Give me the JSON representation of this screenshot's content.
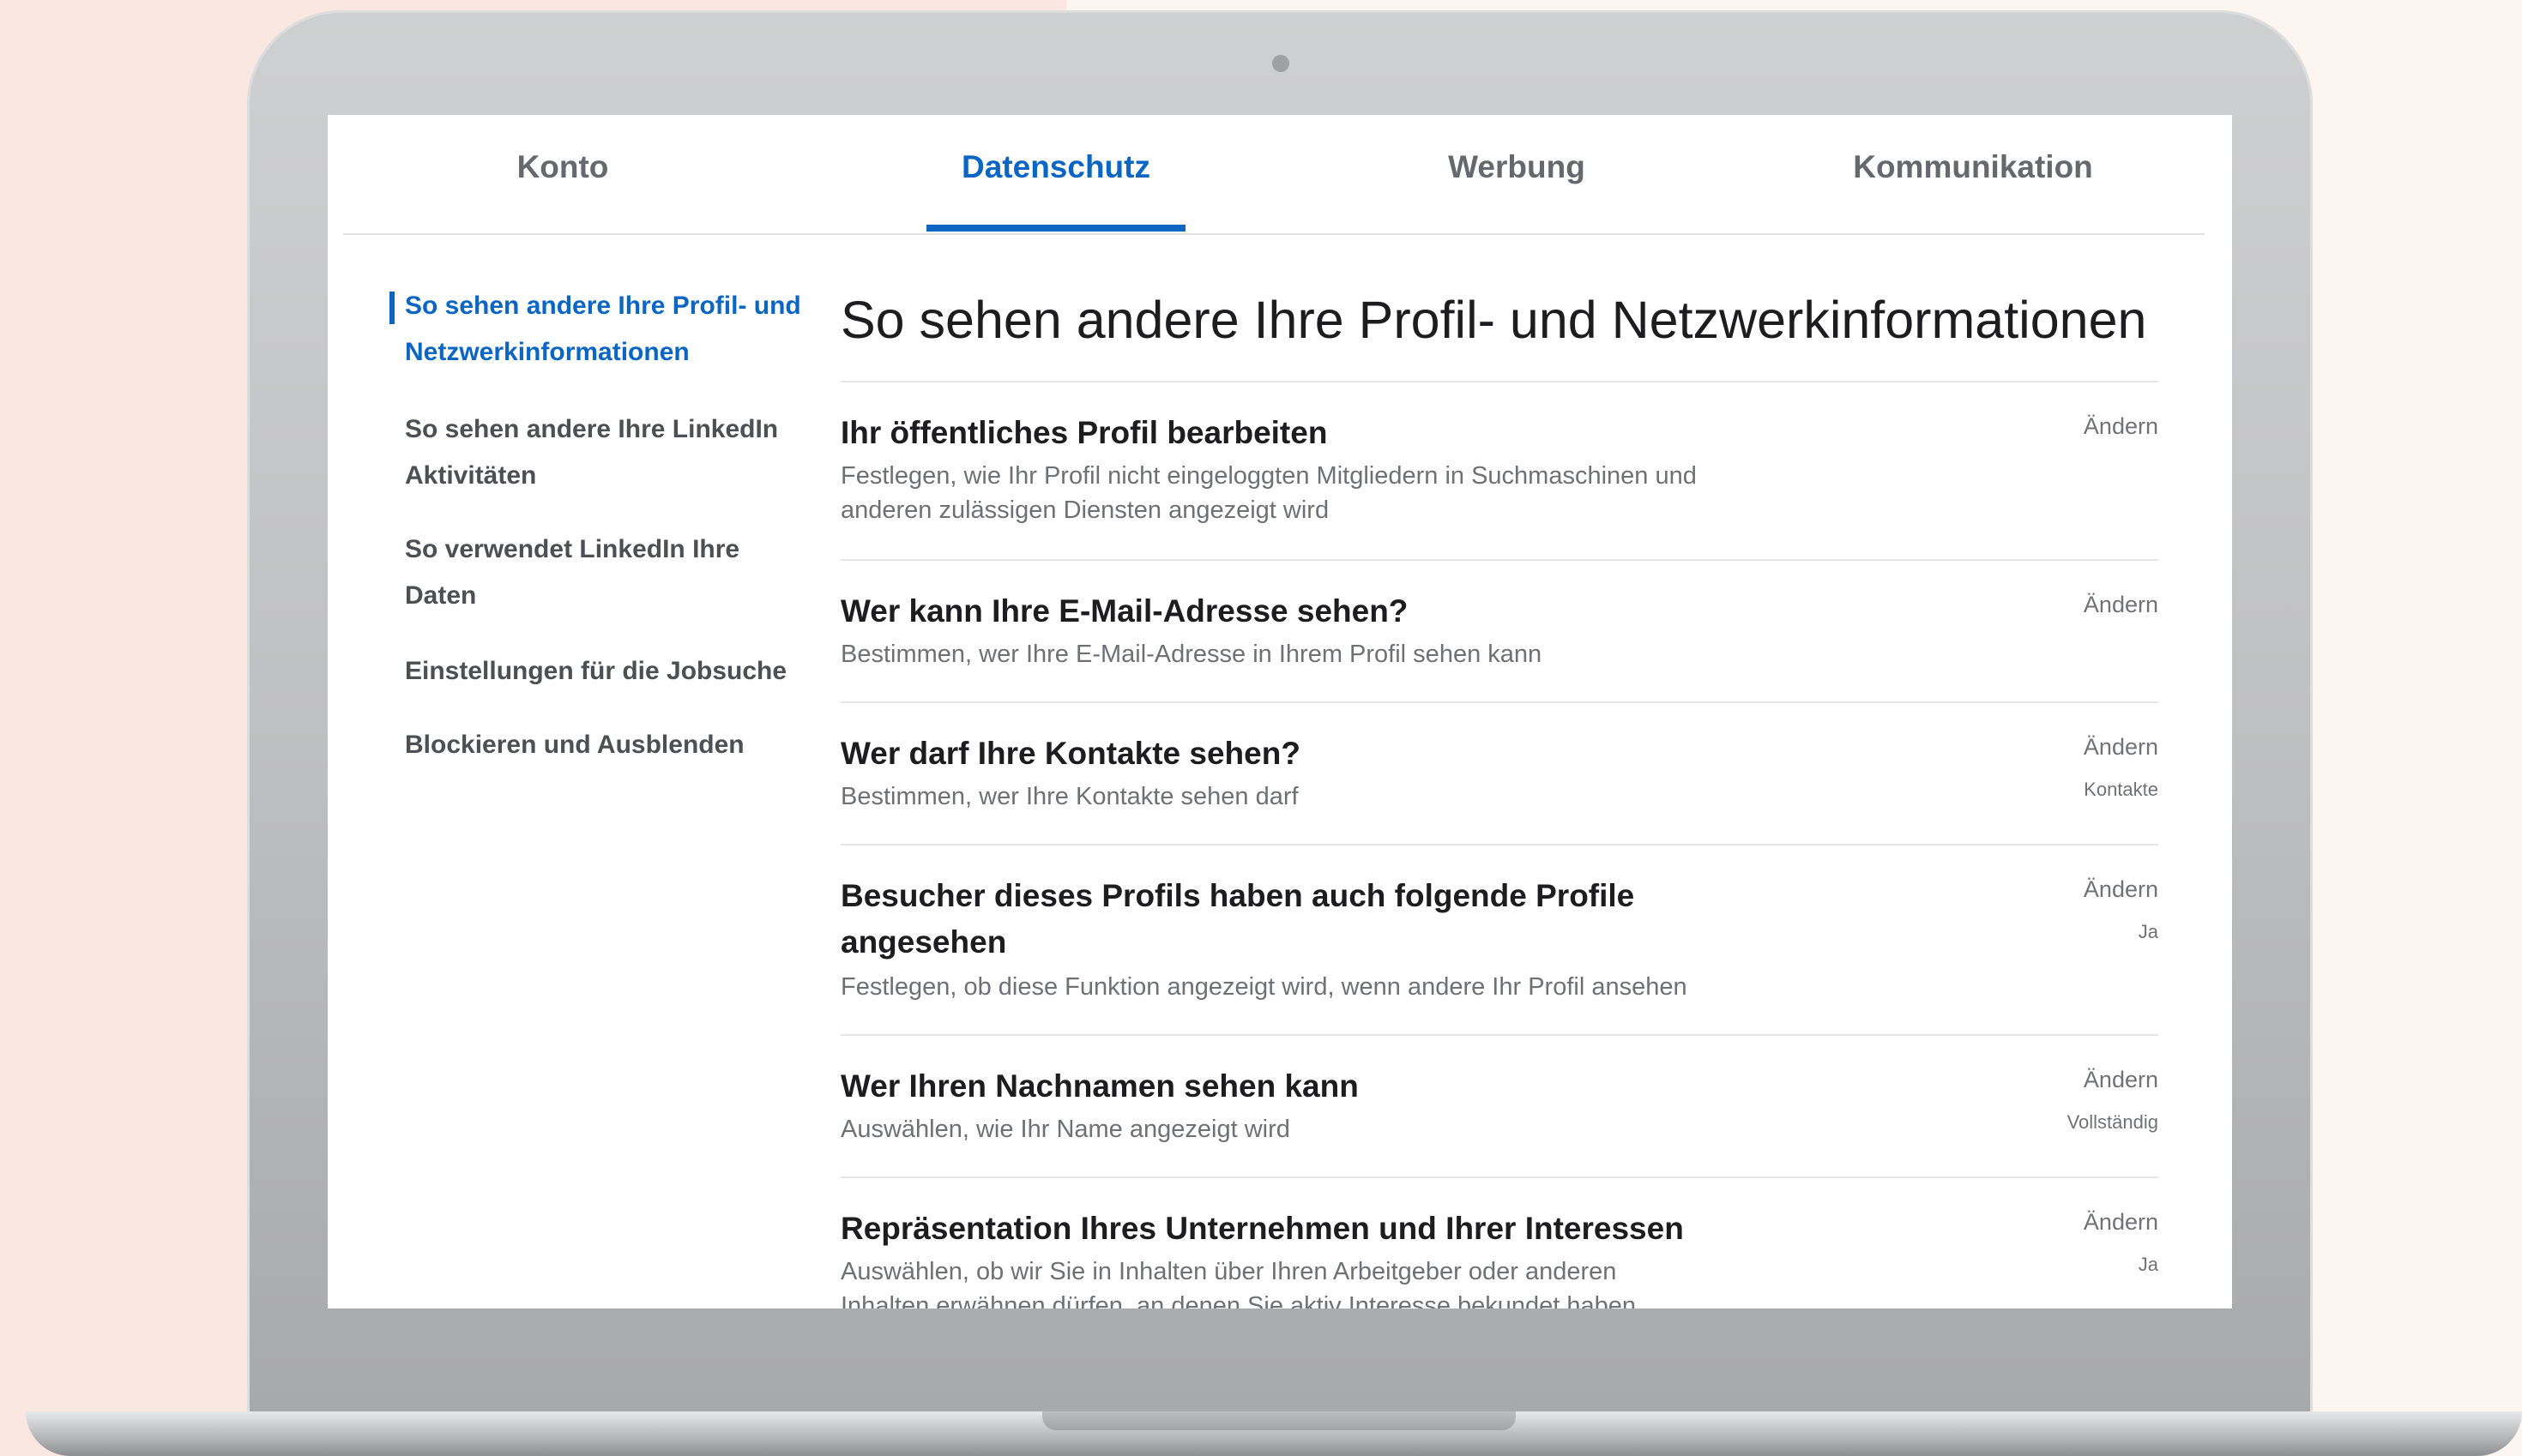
{
  "tabs": [
    {
      "label": "Konto"
    },
    {
      "label": "Datenschutz"
    },
    {
      "label": "Werbung"
    },
    {
      "label": "Kommunikation"
    }
  ],
  "active_tab": "Datenschutz",
  "sidebar": {
    "items": [
      {
        "line1": "So sehen andere Ihre Profil- und",
        "line2": "Netzwerkinformationen",
        "active": true
      },
      {
        "line1": "So sehen andere Ihre LinkedIn",
        "line2": "Aktivitäten"
      },
      {
        "line1": "So verwendet LinkedIn Ihre",
        "line2": "Daten"
      },
      {
        "line1": "Einstellungen für die Jobsuche"
      },
      {
        "line1": "Blockieren und Ausblenden"
      }
    ]
  },
  "main": {
    "title": "So sehen andere Ihre Profil- und Netzwerkinformationen",
    "rows": [
      {
        "title": "Ihr öffentliches Profil bearbeiten",
        "desc1": "Festlegen, wie Ihr Profil nicht eingeloggten Mitgliedern in Suchmaschinen und",
        "desc2": "anderen zulässigen Diensten angezeigt wird",
        "action": "Ändern"
      },
      {
        "title": "Wer kann Ihre E-Mail-Adresse sehen?",
        "desc1": "Bestimmen, wer Ihre E-Mail-Adresse in Ihrem Profil sehen kann",
        "action": "Ändern"
      },
      {
        "title": "Wer darf Ihre Kontakte sehen?",
        "desc1": "Bestimmen, wer Ihre Kontakte sehen darf",
        "action": "Ändern",
        "value": "Kontakte"
      },
      {
        "title1": "Besucher dieses Profils haben auch folgende Profile",
        "title2": "angesehen",
        "desc1": "Festlegen, ob diese Funktion angezeigt wird, wenn andere Ihr Profil ansehen",
        "action": "Ändern",
        "value": "Ja"
      },
      {
        "title": "Wer Ihren Nachnamen sehen kann",
        "desc1": "Auswählen, wie Ihr Name angezeigt wird",
        "action": "Ändern",
        "value": "Vollständig"
      },
      {
        "title": "Repräsentation Ihres Unternehmen und Ihrer Interessen",
        "desc1": "Auswählen, ob wir Sie in Inhalten über Ihren Arbeitgeber oder anderen",
        "desc2": "Inhalten erwähnen dürfen, an denen Sie aktiv Interesse bekundet haben",
        "action": "Ändern",
        "value": "Ja"
      }
    ]
  },
  "colors": {
    "accent": "#0a66c2",
    "text": "#1d1d1f",
    "muted": "#6e7073"
  }
}
